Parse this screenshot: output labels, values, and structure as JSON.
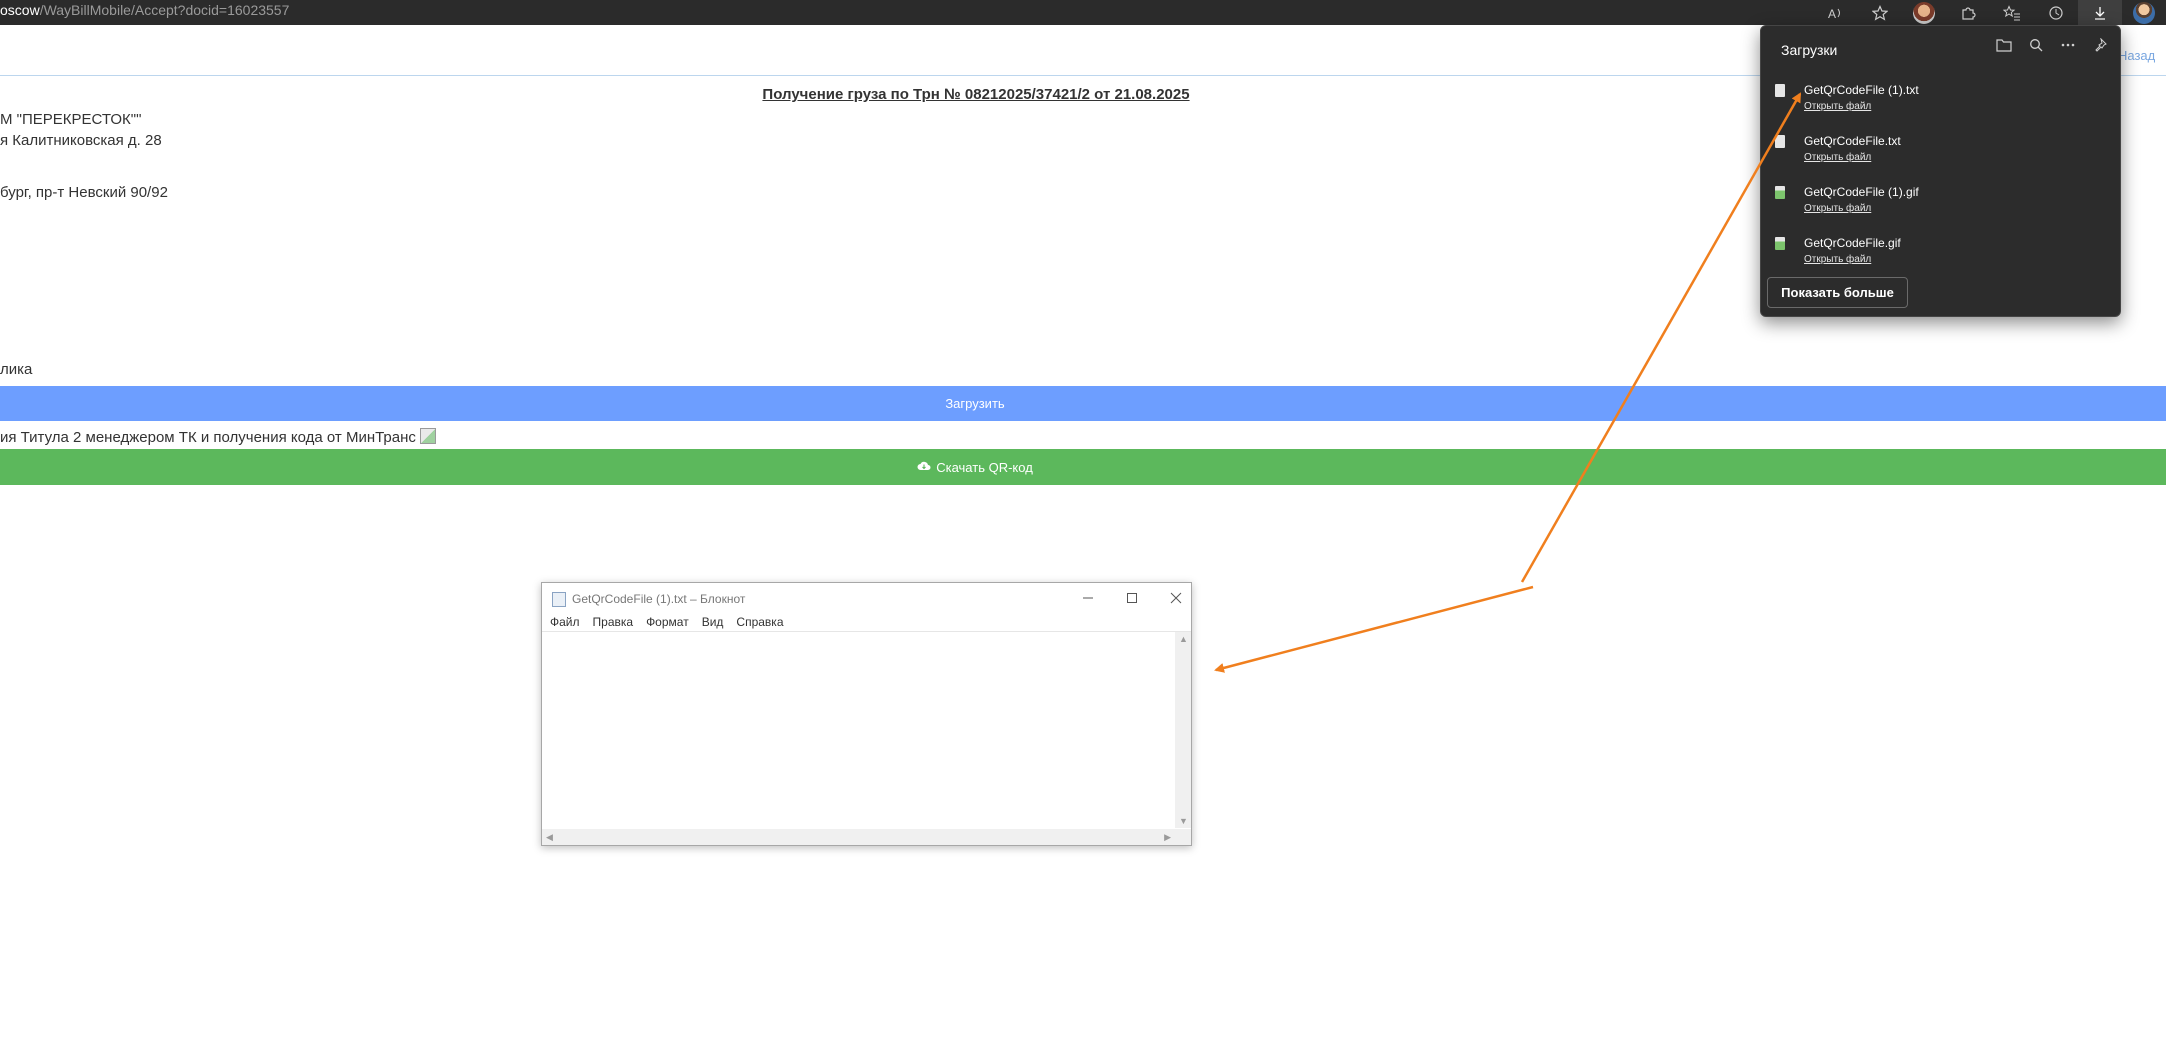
{
  "browser": {
    "url_host": "oscow",
    "url_path": "/WayBillMobile/Accept?docid=16023557",
    "toolbar_icons": [
      "read-aloud-icon",
      "favorite-star-icon",
      "profile-avatar",
      "extensions-icon",
      "favorites-icon",
      "history-icon",
      "downloads-icon",
      "user-avatar"
    ]
  },
  "page": {
    "back_link": "Назад",
    "title": "Получение груза по Трн № 08212025/37421/2 от 21.08.2025",
    "lines": [
      "М \"ПЕРЕКРЕСТОК\"\"",
      "я Калитниковская д. 28",
      "бург, пр-т Невский 90/92",
      "лика"
    ],
    "upload_button": "Загрузить",
    "titul_text": "ия Титула 2 менеджером ТК и получения кода от МинТранс",
    "download_qr_button": "Скачать QR-код"
  },
  "downloads": {
    "title": "Загрузки",
    "actions": [
      "folder-icon",
      "search-icon",
      "more-icon",
      "pin-icon"
    ],
    "items": [
      {
        "name": "GetQrCodeFile (1).txt",
        "open": "Открыть файл",
        "type": "txt"
      },
      {
        "name": "GetQrCodeFile.txt",
        "open": "Открыть файл",
        "type": "txt"
      },
      {
        "name": "GetQrCodeFile (1).gif",
        "open": "Открыть файл",
        "type": "gif"
      },
      {
        "name": "GetQrCodeFile.gif",
        "open": "Открыть файл",
        "type": "gif"
      }
    ],
    "show_more": "Показать больше"
  },
  "notepad": {
    "title": "GetQrCodeFile (1).txt – Блокнот",
    "menu": [
      "Файл",
      "Правка",
      "Формат",
      "Вид",
      "Справка"
    ],
    "content": ""
  },
  "colors": {
    "upload_bar": "#6d9eff",
    "qr_bar": "#5cb85c",
    "annotation_arrow": "#f07f1e",
    "panel_bg": "#2c2c2c"
  }
}
